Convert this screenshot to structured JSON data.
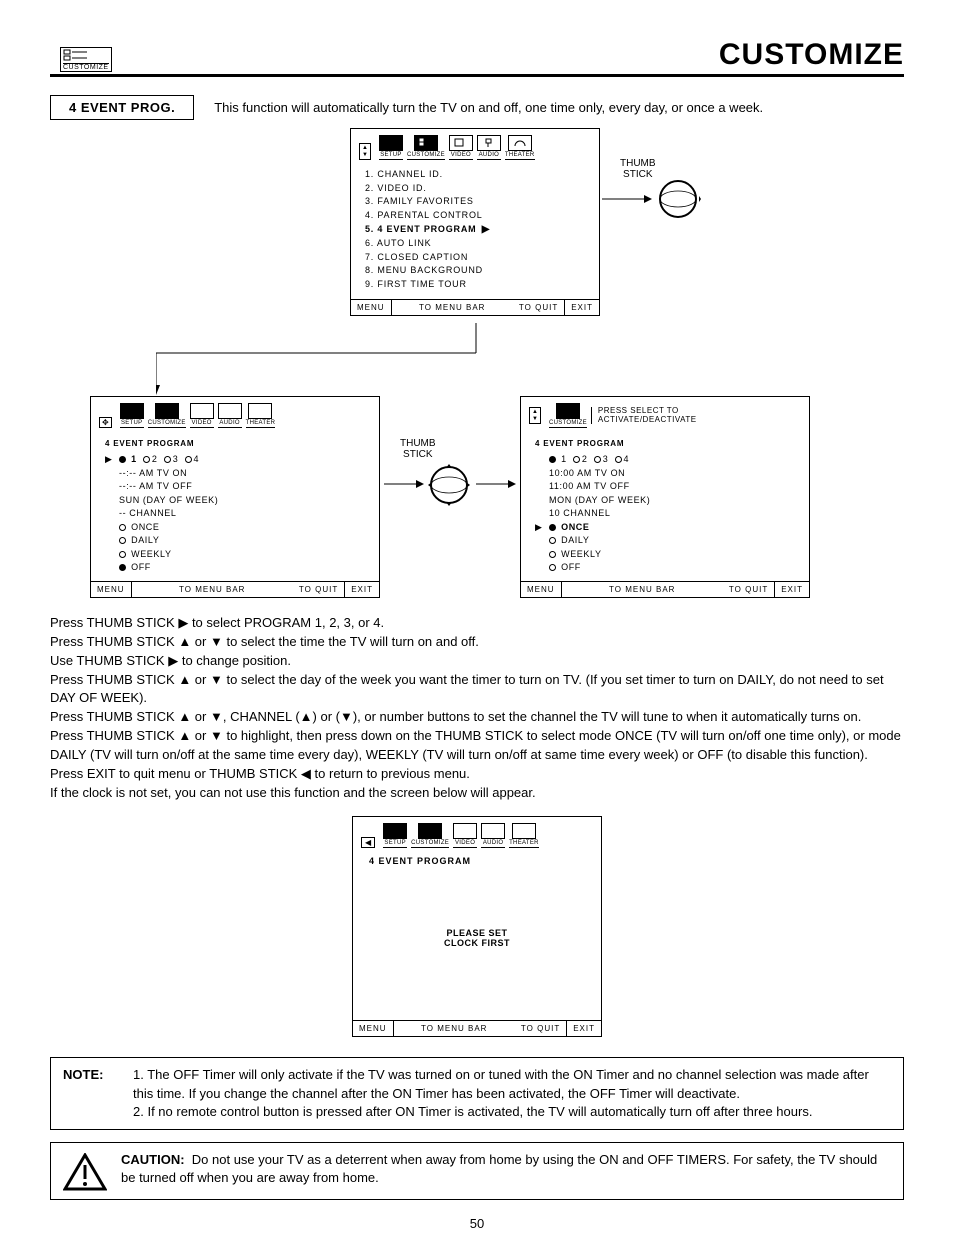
{
  "header": {
    "badge_label": "CUSTOMIZE",
    "title": "CUSTOMIZE"
  },
  "section": {
    "label": "4 EVENT PROG.",
    "description": "This function will automatically turn the TV on and off, one time only, every day, or once a week."
  },
  "osd_top": {
    "tabs": [
      "SETUP",
      "CUSTOMIZE",
      "VIDEO",
      "AUDIO",
      "THEATER"
    ],
    "items": [
      "1. CHANNEL ID.",
      "2. VIDEO ID.",
      "3. FAMILY FAVORITES",
      "4. PARENTAL CONTROL",
      "5. 4 EVENT PROGRAM",
      "6. AUTO LINK",
      "7. CLOSED CAPTION",
      "8. MENU BACKGROUND",
      "9. FIRST TIME TOUR"
    ],
    "highlight_index": 4,
    "footer_menu": "MENU",
    "footer_bar": "TO MENU BAR",
    "footer_quit": "TO QUIT",
    "footer_exit": "EXIT"
  },
  "thumb_label": "THUMB\nSTICK",
  "osd_left": {
    "title": "4 EVENT PROGRAM",
    "programs": [
      "1",
      "2",
      "3",
      "4"
    ],
    "selected_program": 0,
    "rows": [
      "--:-- AM TV ON",
      "--:-- AM TV OFF",
      "SUN (DAY OF WEEK)",
      "-- CHANNEL"
    ],
    "modes": [
      "ONCE",
      "DAILY",
      "WEEKLY",
      "OFF"
    ],
    "selected_mode": 3
  },
  "osd_right": {
    "note": "PRESS SELECT TO\nACTIVATE/DEACTIVATE",
    "title": "4 EVENT PROGRAM",
    "programs": [
      "1",
      "2",
      "3",
      "4"
    ],
    "selected_program": 0,
    "rows": [
      "10:00 AM TV ON",
      "11:00 AM TV OFF",
      "MON (DAY OF WEEK)",
      "10 CHANNEL"
    ],
    "modes": [
      "ONCE",
      "DAILY",
      "WEEKLY",
      "OFF"
    ],
    "selected_mode": 0
  },
  "instructions": [
    "Press THUMB STICK ▶ to select PROGRAM 1, 2, 3, or 4.",
    "Press THUMB STICK ▲ or ▼ to select the time the TV will turn on and off.",
    "Use THUMB STICK ▶ to change position.",
    "Press THUMB STICK ▲ or ▼ to select the day of the week you want the timer to turn on TV. (If you set timer to turn on DAILY, do not need to set DAY OF WEEK).",
    "Press THUMB STICK ▲ or ▼, CHANNEL (▲) or (▼), or number buttons to set the channel the TV will tune to when it automatically turns on.",
    "Press THUMB STICK ▲ or ▼ to highlight, then press down on the THUMB STICK to select mode ONCE (TV will turn on/off one time only), or mode DAILY (TV will turn on/off at the same time every day), WEEKLY (TV will turn on/off at same time every week) or OFF (to disable this function).",
    "Press EXIT to quit menu or THUMB STICK ◀ to return to previous menu.",
    "If the clock is not set, you can not use this function and the screen below will appear."
  ],
  "osd_clock": {
    "title": "4 EVENT PROGRAM",
    "msg1": "PLEASE SET",
    "msg2": "CLOCK FIRST"
  },
  "note_box": {
    "label": "NOTE:",
    "items": [
      "1. The OFF Timer will only activate if the TV was turned on or tuned with the ON Timer and no channel selection was made after this time.  If you change the channel after the ON Timer has been activated, the OFF Timer will deactivate.",
      "2. If no remote control button is pressed after ON Timer is activated, the TV will automatically turn off after three hours."
    ]
  },
  "caution": {
    "label": "CAUTION:",
    "text": "Do not use your TV as a deterrent when away from home by using the ON and OFF TIMERS.  For safety, the TV should be turned off when you are away from home."
  },
  "page_number": "50"
}
